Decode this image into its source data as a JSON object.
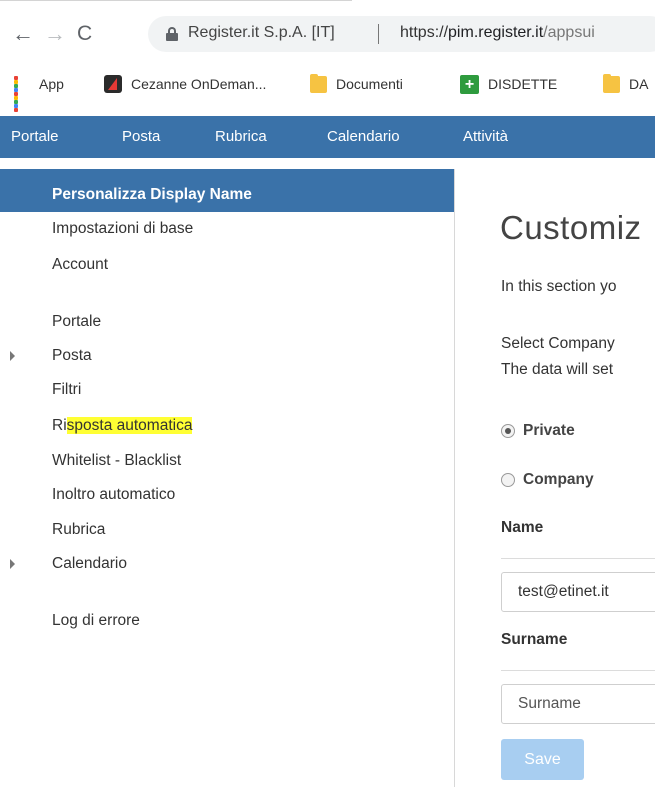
{
  "browser": {
    "nav": {
      "back": "←",
      "forward": "→",
      "reload": "C"
    },
    "site_name": "Register.it S.p.A. [IT]",
    "url_prefix": "https://",
    "url_host": "pim.register.it",
    "url_path": "/appsui",
    "bookmarks": [
      {
        "label": "App",
        "icon": "apps-grid-icon"
      },
      {
        "label": "Cezanne OnDeman...",
        "icon": "cezanne-icon"
      },
      {
        "label": "Documenti",
        "icon": "folder-icon"
      },
      {
        "label": "DISDETTE",
        "icon": "disdette-icon"
      },
      {
        "label": "DA",
        "icon": "folder-icon"
      }
    ]
  },
  "app_nav": {
    "color": "#3a72a9",
    "items": [
      "Portale",
      "Posta",
      "Rubrica",
      "Calendario",
      "Attività"
    ]
  },
  "sidebar": {
    "active": "Personalizza Display Name",
    "items": [
      {
        "label": "Impostazioni di base",
        "expandable": false
      },
      {
        "label": "Account",
        "expandable": false
      },
      {
        "label": "Portale",
        "expandable": false
      },
      {
        "label": "Posta",
        "expandable": true
      },
      {
        "label": "Filtri",
        "expandable": false
      },
      {
        "label_pre": "Ri",
        "label_hl": "sposta automatica",
        "highlight_color": "#ffff33",
        "expandable": false
      },
      {
        "label": "Whitelist - Blacklist",
        "expandable": false
      },
      {
        "label": "Inoltro automatico",
        "expandable": false
      },
      {
        "label": "Rubrica",
        "expandable": false
      },
      {
        "label": "Calendario",
        "expandable": true
      },
      {
        "label": "Log di errore",
        "expandable": false
      }
    ]
  },
  "main": {
    "title": "Customiz",
    "intro": "In this section yo",
    "select_line1": "Select Company",
    "select_line2": "The data will set",
    "radio_private": "Private",
    "radio_company": "Company",
    "selected": "Private",
    "name_label": "Name",
    "name_value": "test@etinet.it",
    "surname_label": "Surname",
    "surname_placeholder": "Surname",
    "save_label": "Save",
    "save_color": "#a8cef1"
  }
}
